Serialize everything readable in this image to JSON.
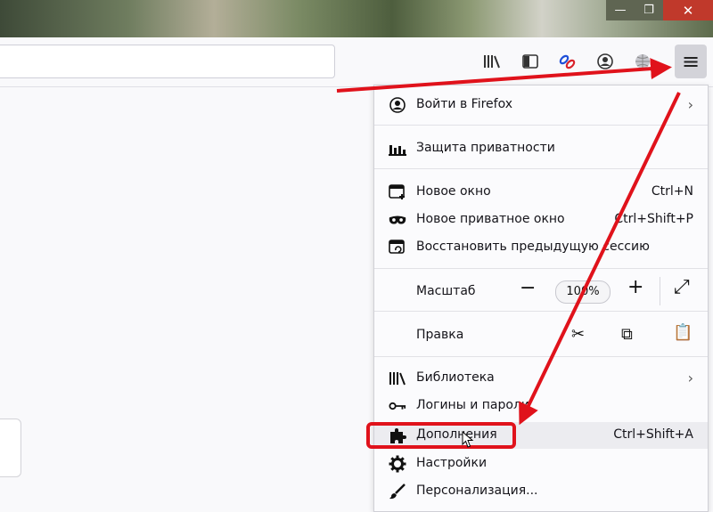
{
  "window": {
    "controls": {
      "minimize": "—",
      "maximize": "❐",
      "close": "✕"
    }
  },
  "toolbar": {
    "icons": [
      "library-icon",
      "sidebar-icon",
      "link-icon",
      "account-icon",
      "globe-icon"
    ],
    "menu_glyph": "≡"
  },
  "menu": {
    "items": [
      {
        "icon": "account-icon",
        "label": "Войти в Firefox",
        "shortcut": "",
        "submenu": true
      },
      {
        "icon": "privacy-icon",
        "label": "Защита приватности",
        "shortcut": "",
        "submenu": false
      },
      {
        "icon": "new-window-icon",
        "label": "Новое окно",
        "shortcut": "Ctrl+N",
        "submenu": false
      },
      {
        "icon": "private-mask-icon",
        "label": "Новое приватное окно",
        "shortcut": "Ctrl+Shift+P",
        "submenu": false
      },
      {
        "icon": "restore-session-icon",
        "label": "Восстановить предыдущую сессию",
        "shortcut": "",
        "submenu": false
      },
      {
        "icon": "library-icon",
        "label": "Библиотека",
        "shortcut": "",
        "submenu": true
      },
      {
        "icon": "key-icon",
        "label": "Логины и пароли",
        "shortcut": "",
        "submenu": false
      },
      {
        "icon": "puzzle-icon",
        "label": "Дополнения",
        "shortcut": "Ctrl+Shift+A",
        "submenu": false
      },
      {
        "icon": "gear-icon",
        "label": "Настройки",
        "shortcut": "",
        "submenu": false
      },
      {
        "icon": "brush-icon",
        "label": "Персонализация...",
        "shortcut": "",
        "submenu": false
      }
    ],
    "zoom": {
      "label": "Масштаб",
      "minus": "−",
      "value": "100%",
      "plus": "+",
      "fullscreen": "⤢"
    },
    "edit": {
      "label": "Правка",
      "cut": "✂",
      "copy": "⧉",
      "paste": "📋"
    }
  },
  "annotation": {
    "highlight_color": "#e0121b",
    "highlighted_item": "Дополнения"
  }
}
